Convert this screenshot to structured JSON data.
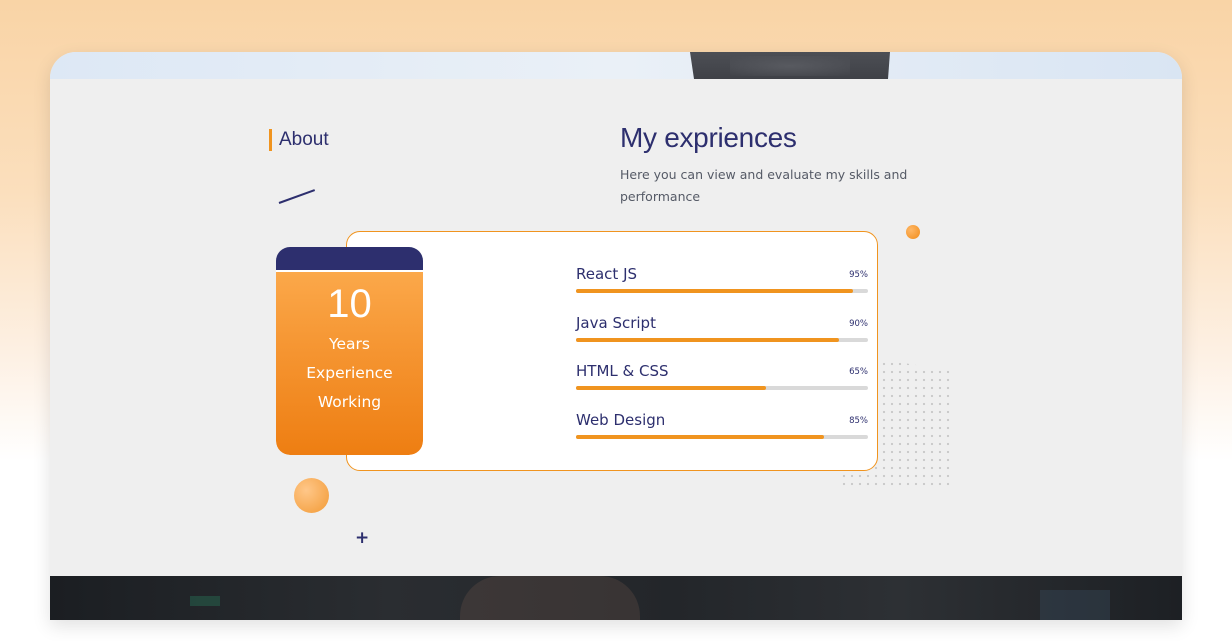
{
  "about": {
    "label": "About"
  },
  "header": {
    "title": "My expriences",
    "subtitle": "Here you can view and evaluate my skills and performance"
  },
  "experience": {
    "years": "10",
    "line1": "Years",
    "line2": "Experience",
    "line3": "Working"
  },
  "skills": [
    {
      "name": "React JS",
      "percent_label": "95%",
      "level": 0.95
    },
    {
      "name": "Java Script",
      "percent_label": "90%",
      "level": 0.9
    },
    {
      "name": "HTML & CSS",
      "percent_label": "65%",
      "level": 0.65
    },
    {
      "name": "Web Design",
      "percent_label": "85%",
      "level": 0.85
    }
  ],
  "colors": {
    "accent": "#f0941f",
    "navy": "#2d2f6e",
    "track": "#d9d9d9"
  },
  "icons": {
    "plus": "plus-icon"
  }
}
